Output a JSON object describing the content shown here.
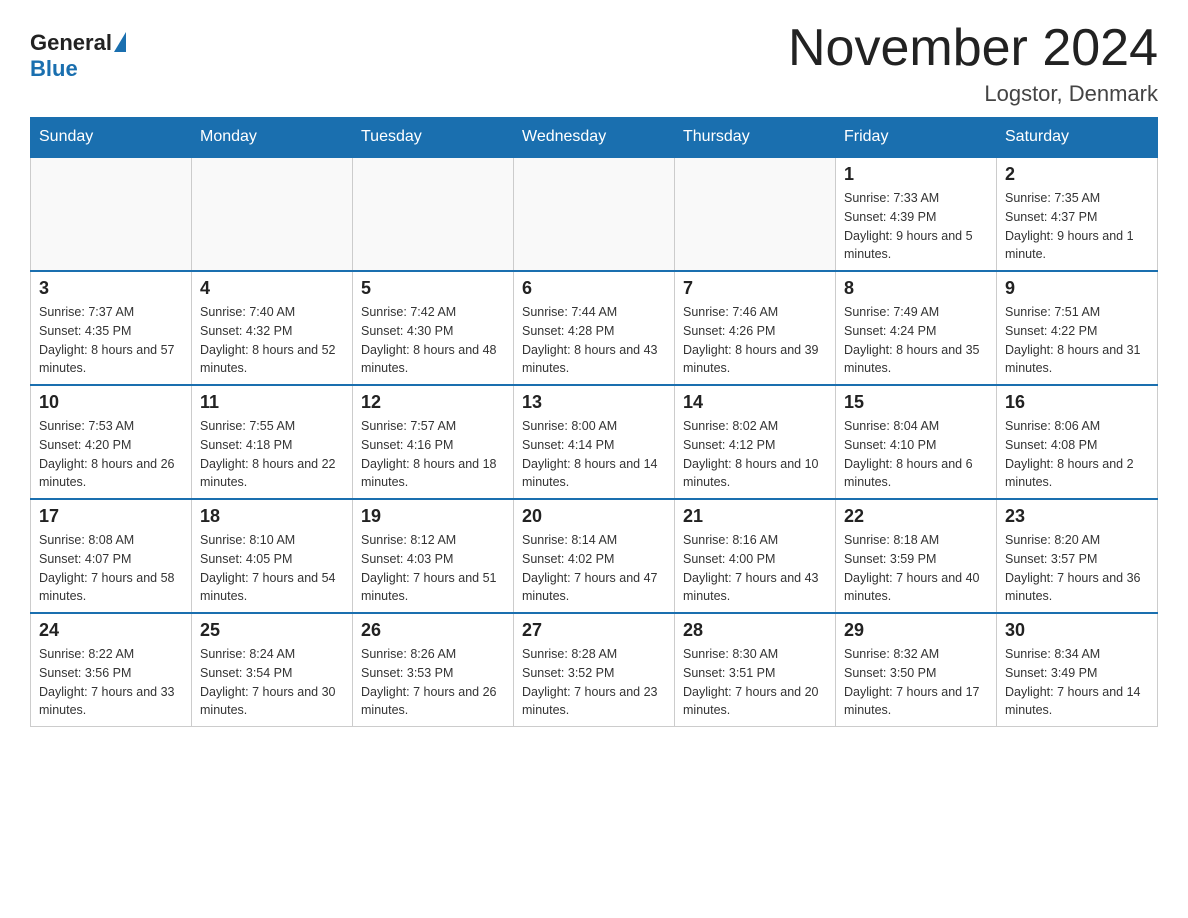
{
  "header": {
    "logo_general": "General",
    "logo_blue": "Blue",
    "month_title": "November 2024",
    "location": "Logstor, Denmark"
  },
  "days_of_week": [
    "Sunday",
    "Monday",
    "Tuesday",
    "Wednesday",
    "Thursday",
    "Friday",
    "Saturday"
  ],
  "weeks": [
    [
      {
        "day": "",
        "sunrise": "",
        "sunset": "",
        "daylight": ""
      },
      {
        "day": "",
        "sunrise": "",
        "sunset": "",
        "daylight": ""
      },
      {
        "day": "",
        "sunrise": "",
        "sunset": "",
        "daylight": ""
      },
      {
        "day": "",
        "sunrise": "",
        "sunset": "",
        "daylight": ""
      },
      {
        "day": "",
        "sunrise": "",
        "sunset": "",
        "daylight": ""
      },
      {
        "day": "1",
        "sunrise": "Sunrise: 7:33 AM",
        "sunset": "Sunset: 4:39 PM",
        "daylight": "Daylight: 9 hours and 5 minutes."
      },
      {
        "day": "2",
        "sunrise": "Sunrise: 7:35 AM",
        "sunset": "Sunset: 4:37 PM",
        "daylight": "Daylight: 9 hours and 1 minute."
      }
    ],
    [
      {
        "day": "3",
        "sunrise": "Sunrise: 7:37 AM",
        "sunset": "Sunset: 4:35 PM",
        "daylight": "Daylight: 8 hours and 57 minutes."
      },
      {
        "day": "4",
        "sunrise": "Sunrise: 7:40 AM",
        "sunset": "Sunset: 4:32 PM",
        "daylight": "Daylight: 8 hours and 52 minutes."
      },
      {
        "day": "5",
        "sunrise": "Sunrise: 7:42 AM",
        "sunset": "Sunset: 4:30 PM",
        "daylight": "Daylight: 8 hours and 48 minutes."
      },
      {
        "day": "6",
        "sunrise": "Sunrise: 7:44 AM",
        "sunset": "Sunset: 4:28 PM",
        "daylight": "Daylight: 8 hours and 43 minutes."
      },
      {
        "day": "7",
        "sunrise": "Sunrise: 7:46 AM",
        "sunset": "Sunset: 4:26 PM",
        "daylight": "Daylight: 8 hours and 39 minutes."
      },
      {
        "day": "8",
        "sunrise": "Sunrise: 7:49 AM",
        "sunset": "Sunset: 4:24 PM",
        "daylight": "Daylight: 8 hours and 35 minutes."
      },
      {
        "day": "9",
        "sunrise": "Sunrise: 7:51 AM",
        "sunset": "Sunset: 4:22 PM",
        "daylight": "Daylight: 8 hours and 31 minutes."
      }
    ],
    [
      {
        "day": "10",
        "sunrise": "Sunrise: 7:53 AM",
        "sunset": "Sunset: 4:20 PM",
        "daylight": "Daylight: 8 hours and 26 minutes."
      },
      {
        "day": "11",
        "sunrise": "Sunrise: 7:55 AM",
        "sunset": "Sunset: 4:18 PM",
        "daylight": "Daylight: 8 hours and 22 minutes."
      },
      {
        "day": "12",
        "sunrise": "Sunrise: 7:57 AM",
        "sunset": "Sunset: 4:16 PM",
        "daylight": "Daylight: 8 hours and 18 minutes."
      },
      {
        "day": "13",
        "sunrise": "Sunrise: 8:00 AM",
        "sunset": "Sunset: 4:14 PM",
        "daylight": "Daylight: 8 hours and 14 minutes."
      },
      {
        "day": "14",
        "sunrise": "Sunrise: 8:02 AM",
        "sunset": "Sunset: 4:12 PM",
        "daylight": "Daylight: 8 hours and 10 minutes."
      },
      {
        "day": "15",
        "sunrise": "Sunrise: 8:04 AM",
        "sunset": "Sunset: 4:10 PM",
        "daylight": "Daylight: 8 hours and 6 minutes."
      },
      {
        "day": "16",
        "sunrise": "Sunrise: 8:06 AM",
        "sunset": "Sunset: 4:08 PM",
        "daylight": "Daylight: 8 hours and 2 minutes."
      }
    ],
    [
      {
        "day": "17",
        "sunrise": "Sunrise: 8:08 AM",
        "sunset": "Sunset: 4:07 PM",
        "daylight": "Daylight: 7 hours and 58 minutes."
      },
      {
        "day": "18",
        "sunrise": "Sunrise: 8:10 AM",
        "sunset": "Sunset: 4:05 PM",
        "daylight": "Daylight: 7 hours and 54 minutes."
      },
      {
        "day": "19",
        "sunrise": "Sunrise: 8:12 AM",
        "sunset": "Sunset: 4:03 PM",
        "daylight": "Daylight: 7 hours and 51 minutes."
      },
      {
        "day": "20",
        "sunrise": "Sunrise: 8:14 AM",
        "sunset": "Sunset: 4:02 PM",
        "daylight": "Daylight: 7 hours and 47 minutes."
      },
      {
        "day": "21",
        "sunrise": "Sunrise: 8:16 AM",
        "sunset": "Sunset: 4:00 PM",
        "daylight": "Daylight: 7 hours and 43 minutes."
      },
      {
        "day": "22",
        "sunrise": "Sunrise: 8:18 AM",
        "sunset": "Sunset: 3:59 PM",
        "daylight": "Daylight: 7 hours and 40 minutes."
      },
      {
        "day": "23",
        "sunrise": "Sunrise: 8:20 AM",
        "sunset": "Sunset: 3:57 PM",
        "daylight": "Daylight: 7 hours and 36 minutes."
      }
    ],
    [
      {
        "day": "24",
        "sunrise": "Sunrise: 8:22 AM",
        "sunset": "Sunset: 3:56 PM",
        "daylight": "Daylight: 7 hours and 33 minutes."
      },
      {
        "day": "25",
        "sunrise": "Sunrise: 8:24 AM",
        "sunset": "Sunset: 3:54 PM",
        "daylight": "Daylight: 7 hours and 30 minutes."
      },
      {
        "day": "26",
        "sunrise": "Sunrise: 8:26 AM",
        "sunset": "Sunset: 3:53 PM",
        "daylight": "Daylight: 7 hours and 26 minutes."
      },
      {
        "day": "27",
        "sunrise": "Sunrise: 8:28 AM",
        "sunset": "Sunset: 3:52 PM",
        "daylight": "Daylight: 7 hours and 23 minutes."
      },
      {
        "day": "28",
        "sunrise": "Sunrise: 8:30 AM",
        "sunset": "Sunset: 3:51 PM",
        "daylight": "Daylight: 7 hours and 20 minutes."
      },
      {
        "day": "29",
        "sunrise": "Sunrise: 8:32 AM",
        "sunset": "Sunset: 3:50 PM",
        "daylight": "Daylight: 7 hours and 17 minutes."
      },
      {
        "day": "30",
        "sunrise": "Sunrise: 8:34 AM",
        "sunset": "Sunset: 3:49 PM",
        "daylight": "Daylight: 7 hours and 14 minutes."
      }
    ]
  ]
}
